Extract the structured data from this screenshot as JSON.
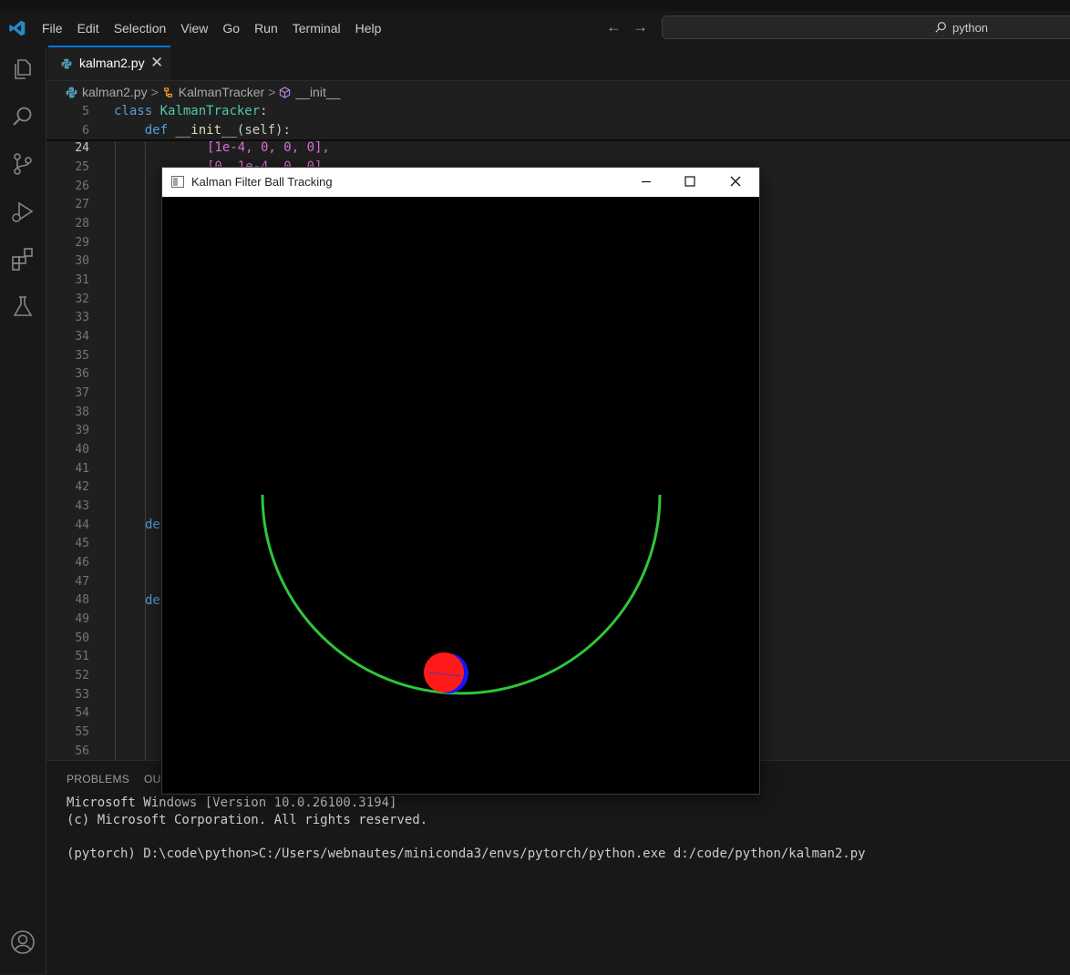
{
  "menu": [
    "File",
    "Edit",
    "Selection",
    "View",
    "Go",
    "Run",
    "Terminal",
    "Help"
  ],
  "command_center": {
    "text": "python"
  },
  "tab": {
    "label": "kalman2.py",
    "close": "✕"
  },
  "breadcrumb": {
    "file": "kalman2.py",
    "class": "KalmanTracker",
    "method": "__init__",
    "sep": ">"
  },
  "editor": {
    "sticky": [
      {
        "num": "5",
        "kw": "class",
        "name": "KalmanTracker",
        "rest": ":"
      },
      {
        "num": "6",
        "kw": "def",
        "name": "__init__",
        "rest": "(self):"
      }
    ],
    "line_numbers": [
      "24",
      "25",
      "26",
      "27",
      "28",
      "29",
      "30",
      "31",
      "32",
      "33",
      "34",
      "35",
      "36",
      "37",
      "38",
      "39",
      "40",
      "41",
      "42",
      "43",
      "44",
      "45",
      "46",
      "47",
      "48",
      "49",
      "50",
      "51",
      "52",
      "53",
      "54",
      "55",
      "56"
    ],
    "line24_text": "[1e-4, 0, 0, 0],",
    "line25_partial": "[0, 1e-4, 0, 0]",
    "line44_partial": "de",
    "line48_partial": "de"
  },
  "panel": {
    "tabs": [
      "PROBLEMS",
      "OUT"
    ],
    "terminal": [
      "Microsoft Windows [Version 10.0.26100.3194]",
      "(c) Microsoft Corporation. All rights reserved.",
      "(pytorch) D:\\code\\python>C:/Users/webnautes/miniconda3/envs/pytorch/python.exe d:/code/python/kalman2.py"
    ]
  },
  "cv_window": {
    "title": "Kalman Filter Ball Tracking",
    "colors": {
      "track": "#2ec63a",
      "ball_measured": "#ff1a1a",
      "ball_estimate": "#1515ff"
    }
  },
  "colors": {
    "accent": "#0078d4",
    "editor_bg": "#1f1f1f"
  }
}
